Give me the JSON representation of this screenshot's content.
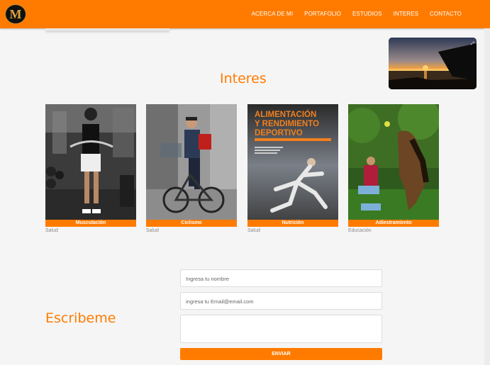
{
  "header": {
    "logo_text": "M",
    "nav": [
      "ACERCA DE MI",
      "PORTAFOLIO",
      "ESTUDIOS",
      "INTERES",
      "CONTACTO"
    ]
  },
  "video": {
    "caption": ""
  },
  "interes": {
    "title": "Interes",
    "cards": [
      {
        "label": "Musculación",
        "category": "Salud",
        "image": "gym-photo"
      },
      {
        "label": "Ciclismo",
        "category": "Salud",
        "image": "cyclist-photo"
      },
      {
        "label": "Nutrición",
        "category": "Salud",
        "image": "nutrition-book-cover",
        "cover_title": "ALIMENTACIÓN Y RENDIMIENTO DEPORTIVO"
      },
      {
        "label": "Adiestramiento",
        "category": "Educación",
        "image": "dog-training-photo"
      }
    ]
  },
  "contact": {
    "title": "Escribeme",
    "name_placeholder": "Ingresa tu nombre",
    "email_placeholder": "ingresa tu Email@email.com",
    "message_placeholder": "",
    "submit_label": "ENVIAR"
  },
  "colors": {
    "accent": "#ff7b00",
    "background": "#f5f5f5"
  }
}
